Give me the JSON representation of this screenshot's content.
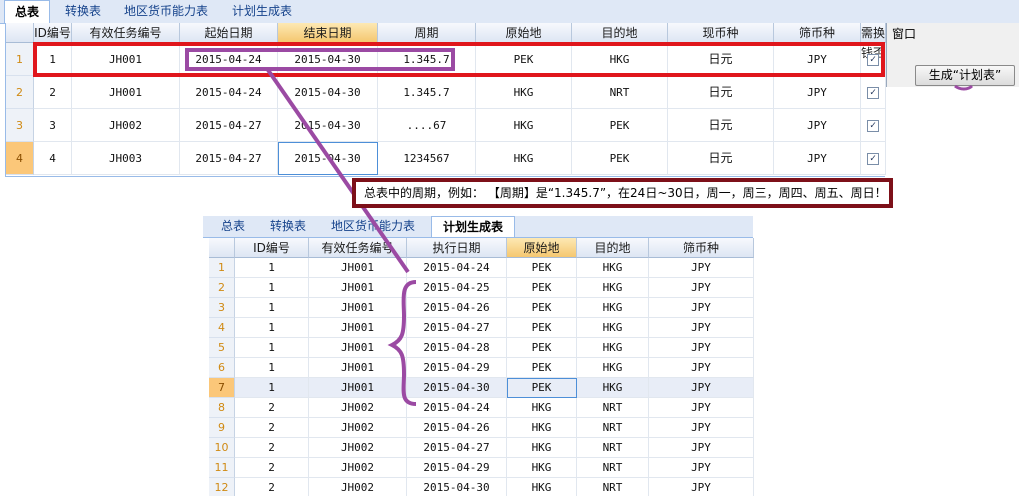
{
  "top_panel": {
    "tabs": [
      "总表",
      "转换表",
      "地区货币能力表",
      "计划生成表"
    ],
    "active_tab": "总表",
    "columns": [
      "ID编号",
      "有效任务编号",
      "起始日期",
      "结束日期",
      "周期",
      "原始地",
      "目的地",
      "现币种",
      "筛币种",
      "需换钱否"
    ],
    "sorted_column": "结束日期",
    "rows": [
      {
        "no": "1",
        "id": "1",
        "task": "JH001",
        "start": "2015-04-24",
        "end": "2015-04-30",
        "period": "1.345.7",
        "origin": "PEK",
        "dest": "HKG",
        "cur": "日元",
        "target": "JPY",
        "exchange": true
      },
      {
        "no": "2",
        "id": "2",
        "task": "JH001",
        "start": "2015-04-24",
        "end": "2015-04-30",
        "period": "1.345.7",
        "origin": "HKG",
        "dest": "NRT",
        "cur": "日元",
        "target": "JPY",
        "exchange": true
      },
      {
        "no": "3",
        "id": "3",
        "task": "JH002",
        "start": "2015-04-27",
        "end": "2015-04-30",
        "period": "....67",
        "origin": "HKG",
        "dest": "PEK",
        "cur": "日元",
        "target": "JPY",
        "exchange": true
      },
      {
        "no": "4",
        "id": "4",
        "task": "JH003",
        "start": "2015-04-27",
        "end": "2015-04-30",
        "period": "1234567",
        "origin": "HKG",
        "dest": "PEK",
        "cur": "日元",
        "target": "JPY",
        "exchange": true
      }
    ],
    "selected_row": "4",
    "check_glyph": "✓"
  },
  "side_panel": {
    "window_label": "窗口",
    "generate_button": "生成“计划表”"
  },
  "note": "总表中的周期，例如：  【周期】是“1.345.7”，在24日~30日，周一，周三，周四、周五、周日！",
  "bottom_panel": {
    "tabs": [
      "总表",
      "转换表",
      "地区货币能力表",
      "计划生成表"
    ],
    "active_tab": "计划生成表",
    "columns": [
      "ID编号",
      "有效任务编号",
      "执行日期",
      "原始地",
      "目的地",
      "筛币种"
    ],
    "sorted_column": "原始地",
    "rows": [
      {
        "no": "1",
        "id": "1",
        "task": "JH001",
        "date": "2015-04-24",
        "origin": "PEK",
        "dest": "HKG",
        "target": "JPY"
      },
      {
        "no": "2",
        "id": "1",
        "task": "JH001",
        "date": "2015-04-25",
        "origin": "PEK",
        "dest": "HKG",
        "target": "JPY"
      },
      {
        "no": "3",
        "id": "1",
        "task": "JH001",
        "date": "2015-04-26",
        "origin": "PEK",
        "dest": "HKG",
        "target": "JPY"
      },
      {
        "no": "4",
        "id": "1",
        "task": "JH001",
        "date": "2015-04-27",
        "origin": "PEK",
        "dest": "HKG",
        "target": "JPY"
      },
      {
        "no": "5",
        "id": "1",
        "task": "JH001",
        "date": "2015-04-28",
        "origin": "PEK",
        "dest": "HKG",
        "target": "JPY"
      },
      {
        "no": "6",
        "id": "1",
        "task": "JH001",
        "date": "2015-04-29",
        "origin": "PEK",
        "dest": "HKG",
        "target": "JPY"
      },
      {
        "no": "7",
        "id": "1",
        "task": "JH001",
        "date": "2015-04-30",
        "origin": "PEK",
        "dest": "HKG",
        "target": "JPY"
      },
      {
        "no": "8",
        "id": "2",
        "task": "JH002",
        "date": "2015-04-24",
        "origin": "HKG",
        "dest": "NRT",
        "target": "JPY"
      },
      {
        "no": "9",
        "id": "2",
        "task": "JH002",
        "date": "2015-04-26",
        "origin": "HKG",
        "dest": "NRT",
        "target": "JPY"
      },
      {
        "no": "10",
        "id": "2",
        "task": "JH002",
        "date": "2015-04-27",
        "origin": "HKG",
        "dest": "NRT",
        "target": "JPY"
      },
      {
        "no": "11",
        "id": "2",
        "task": "JH002",
        "date": "2015-04-29",
        "origin": "HKG",
        "dest": "NRT",
        "target": "JPY"
      },
      {
        "no": "12",
        "id": "2",
        "task": "JH002",
        "date": "2015-04-30",
        "origin": "HKG",
        "dest": "NRT",
        "target": "JPY"
      }
    ],
    "selected_row": "7"
  },
  "colors": {
    "highlight_red": "#e0161c",
    "annotation_purple": "#9b4aa3",
    "note_border": "#7d1019",
    "sorted_header": "#f5c770"
  }
}
